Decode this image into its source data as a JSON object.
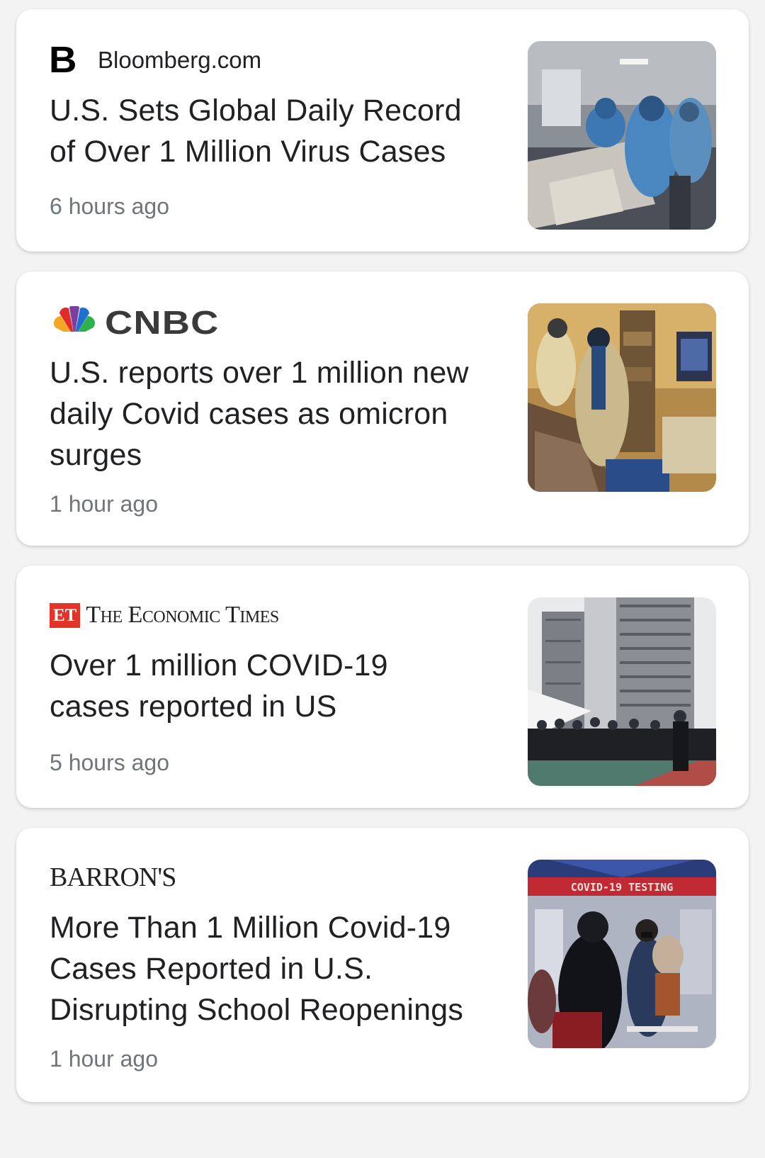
{
  "articles": [
    {
      "source": "Bloomberg.com",
      "source_logo": "B",
      "headline_lines": [
        "U.S. Sets Global Daily Record",
        "of Over 1 Million Virus Cases"
      ],
      "time": "6 hours ago",
      "thumbnail": "hospital-icu-photo"
    },
    {
      "source": "CNBC",
      "source_logo": "cnbc-peacock-icon",
      "headline_lines": [
        "U.S. reports over 1 million new",
        "daily Covid cases as omicron",
        "surges"
      ],
      "time": "1 hour ago",
      "thumbnail": "hospital-room-photo"
    },
    {
      "source": "The Economic Times",
      "source_logo": "ET",
      "headline_lines": [
        "Over 1 million COVID-19",
        "cases reported in US"
      ],
      "time": "5 hours ago",
      "thumbnail": "testing-line-photo"
    },
    {
      "source": "BARRON'S",
      "source_logo": "",
      "headline_lines": [
        "More Than 1 Million Covid-19",
        "Cases Reported in U.S.",
        "Disrupting School Reopenings"
      ],
      "time": "1 hour ago",
      "thumbnail": "covid-testing-tent-photo",
      "thumbnail_sign": "COVID-19 TESTING"
    }
  ],
  "colors": {
    "card_bg": "#ffffff",
    "page_bg": "#f3f3f3",
    "headline": "#202124",
    "time": "#70757a",
    "et_red": "#e3342a"
  }
}
